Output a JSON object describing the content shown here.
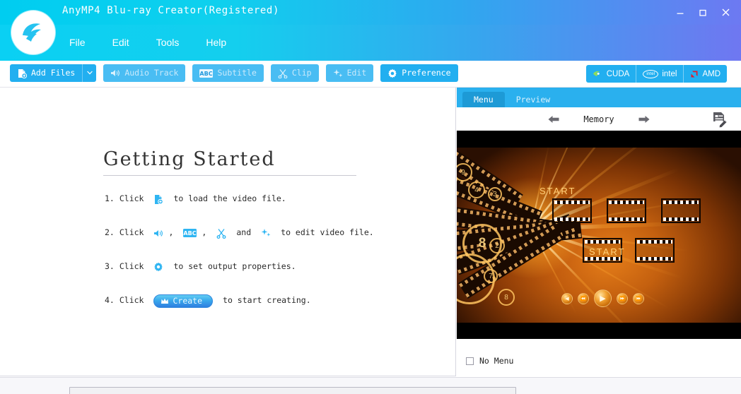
{
  "window": {
    "title": "AnyMP4 Blu-ray Creator(Registered)",
    "controls": {
      "minimize": "minimize-icon",
      "maximize": "maximize-icon",
      "close": "close-icon"
    },
    "logo_alt": "anymp4-logo",
    "titlebar_gradient_start": "#00cdf0",
    "titlebar_gradient_end": "#6d79f2"
  },
  "menubar": {
    "items": [
      {
        "label": "File"
      },
      {
        "label": "Edit"
      },
      {
        "label": "Tools"
      },
      {
        "label": "Help"
      }
    ]
  },
  "toolbar": {
    "accent": "#22aff0",
    "buttons": [
      {
        "label": "Add Files",
        "icon": "add-file-icon",
        "enabled": true,
        "has_dropdown": true,
        "dropdown_icon": "chevron-down-icon"
      },
      {
        "label": "Audio Track",
        "icon": "speaker-icon",
        "enabled": false
      },
      {
        "label": "Subtitle",
        "icon": "abc-icon",
        "enabled": false
      },
      {
        "label": "Clip",
        "icon": "scissors-icon",
        "enabled": false
      },
      {
        "label": "Edit",
        "icon": "sparkle-icon",
        "enabled": false
      },
      {
        "label": "Preference",
        "icon": "gear-icon",
        "enabled": true
      }
    ],
    "acceleration": [
      {
        "label": "CUDA",
        "icon": "nvidia-icon"
      },
      {
        "label": "intel",
        "icon": "intel-icon",
        "badge_text": "intel"
      },
      {
        "label": "AMD",
        "icon": "amd-icon"
      }
    ]
  },
  "getting_started": {
    "heading": "Getting Started",
    "steps": [
      {
        "number": "1.",
        "lead": "Click",
        "icons": [
          "add-file-icon"
        ],
        "tail": "to load the video file."
      },
      {
        "number": "2.",
        "lead": "Click",
        "icons": [
          "speaker-icon",
          "abc-icon",
          "scissors-icon",
          "sparkle-icon"
        ],
        "separator_1": ",",
        "separator_2": ",",
        "conjunction": "and",
        "tail": "to edit video file."
      },
      {
        "number": "3.",
        "lead": "Click",
        "icons": [
          "gear-icon"
        ],
        "tail": "to set output properties."
      },
      {
        "number": "4.",
        "lead": "Click",
        "button_label": "Create",
        "button_icon": "crown-icon",
        "tail": "to start creating."
      }
    ]
  },
  "right_panel": {
    "tabs": [
      {
        "label": "Menu",
        "active": true
      },
      {
        "label": "Preview",
        "active": false
      }
    ],
    "template_nav": {
      "prev_icon": "arrow-left-icon",
      "name": "Memory",
      "next_icon": "arrow-right-icon",
      "edit_icon": "edit-menu-icon"
    },
    "preview": {
      "alt": "disc-menu-template-preview",
      "start_label_top": "START",
      "start_label_inner": "START",
      "transport": [
        "prev-track-icon",
        "rewind-icon",
        "play-icon",
        "fast-forward-icon",
        "next-track-icon"
      ]
    },
    "no_menu": {
      "label": "No Menu",
      "checked": false
    }
  }
}
